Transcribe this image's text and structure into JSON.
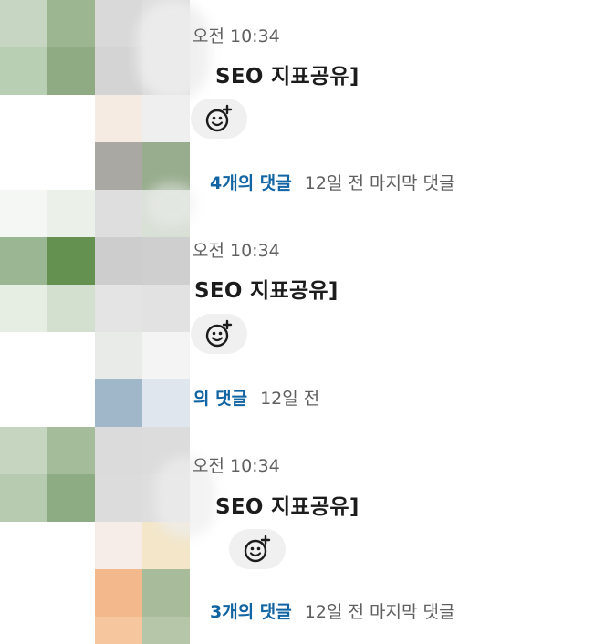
{
  "colors": {
    "link": "#1264a3",
    "text": "#1d1c1d",
    "muted": "#616061",
    "reaction_bg": "#f0f0f0"
  },
  "messages": [
    {
      "time": "오전 10:34",
      "title": "SEO 지표공유]",
      "reaction_icon": "add-reaction-icon",
      "reply_count": "4개의 댓글",
      "reply_meta": "12일 전 마지막 댓글"
    },
    {
      "time": "오전 10:34",
      "title": "SEO 지표공유]",
      "reaction_icon": "add-reaction-icon",
      "reply_count": "의 댓글",
      "reply_meta": "12일 전"
    },
    {
      "time": "오전 10:34",
      "title": "SEO 지표공유]",
      "reaction_icon": "add-reaction-icon",
      "reply_count": "3개의 댓글",
      "reply_meta": "12일 전 마지막 댓글"
    }
  ]
}
